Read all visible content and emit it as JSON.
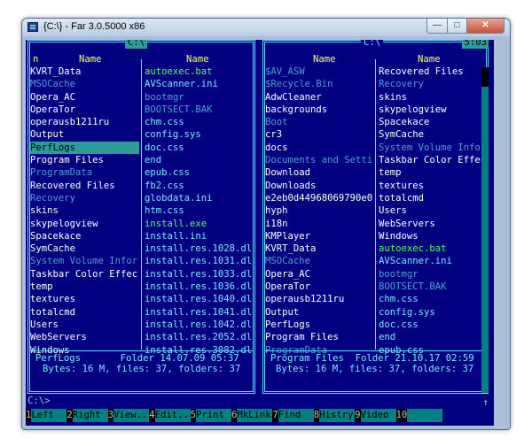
{
  "window": {
    "title": "{C:\\} - Far 3.0.5000 x86",
    "min_icon": "minimize-icon",
    "max_icon": "maximize-icon",
    "close_icon": "close-icon"
  },
  "left_panel": {
    "path": "C:\\",
    "columns": [
      "n",
      "Name",
      "Name"
    ],
    "col1": [
      {
        "name": "KVRT_Data",
        "kind": "n"
      },
      {
        "name": "MSOCache",
        "kind": "h"
      },
      {
        "name": "Opera_AC",
        "kind": "n"
      },
      {
        "name": "OperaTor",
        "kind": "n"
      },
      {
        "name": "operausb1211ru",
        "kind": "n"
      },
      {
        "name": "Output",
        "kind": "n"
      },
      {
        "name": "PerfLogs",
        "kind": "sel"
      },
      {
        "name": "Program Files",
        "kind": "n"
      },
      {
        "name": "ProgramData",
        "kind": "h"
      },
      {
        "name": "Recovered Files",
        "kind": "n"
      },
      {
        "name": "Recovery",
        "kind": "h"
      },
      {
        "name": "skins",
        "kind": "n"
      },
      {
        "name": "skypelogview",
        "kind": "n"
      },
      {
        "name": "Spacekace",
        "kind": "n"
      },
      {
        "name": "SymCache",
        "kind": "n"
      },
      {
        "name": "System Volume Infor",
        "kind": "h"
      },
      {
        "name": "Taskbar Color Effec",
        "kind": "n"
      },
      {
        "name": "temp",
        "kind": "n"
      },
      {
        "name": "textures",
        "kind": "n"
      },
      {
        "name": "totalcmd",
        "kind": "n"
      },
      {
        "name": "Users",
        "kind": "n"
      },
      {
        "name": "WebServers",
        "kind": "n"
      },
      {
        "name": "Windows",
        "kind": "n"
      }
    ],
    "col2": [
      {
        "name": "autoexec.bat",
        "kind": "x"
      },
      {
        "name": "AVScanner.ini",
        "kind": "f"
      },
      {
        "name": "bootmgr",
        "kind": "h"
      },
      {
        "name": "BOOTSECT.BAK",
        "kind": "h"
      },
      {
        "name": "chm.css",
        "kind": "f"
      },
      {
        "name": "config.sys",
        "kind": "f"
      },
      {
        "name": "doc.css",
        "kind": "f"
      },
      {
        "name": "end",
        "kind": "f"
      },
      {
        "name": "epub.css",
        "kind": "f"
      },
      {
        "name": "fb2.css",
        "kind": "f"
      },
      {
        "name": "globdata.ini",
        "kind": "f"
      },
      {
        "name": "htm.css",
        "kind": "f"
      },
      {
        "name": "install.exe",
        "kind": "x"
      },
      {
        "name": "install.ini",
        "kind": "f"
      },
      {
        "name": "install.res.1028.dl}",
        "kind": "f"
      },
      {
        "name": "install.res.1031.dl}",
        "kind": "f"
      },
      {
        "name": "install.res.1033.dl}",
        "kind": "f"
      },
      {
        "name": "install.res.1036.dl}",
        "kind": "f"
      },
      {
        "name": "install.res.1040.dl}",
        "kind": "f"
      },
      {
        "name": "install.res.1041.dl}",
        "kind": "f"
      },
      {
        "name": "install.res.1042.dl}",
        "kind": "f"
      },
      {
        "name": "install.res.2052.dl}",
        "kind": "f"
      },
      {
        "name": "install.res.3082.dl}",
        "kind": "f"
      }
    ],
    "info": "PerfLogs       Folder 14.07.09 05:37",
    "summary": "Bytes: 16 M, files: 37, folders: 37"
  },
  "right_panel": {
    "path": "C:\\",
    "clock": "5:03",
    "columns": [
      "Name",
      "Name"
    ],
    "col1": [
      {
        "name": "$AV_ASW",
        "kind": "h"
      },
      {
        "name": "$Recycle.Bin",
        "kind": "h"
      },
      {
        "name": "AdwCleaner",
        "kind": "n"
      },
      {
        "name": "backgrounds",
        "kind": "n"
      },
      {
        "name": "Boot",
        "kind": "h"
      },
      {
        "name": "cr3",
        "kind": "n"
      },
      {
        "name": "docs",
        "kind": "n"
      },
      {
        "name": "Documents and Setti",
        "kind": "h"
      },
      {
        "name": "Download",
        "kind": "n"
      },
      {
        "name": "Downloads",
        "kind": "n"
      },
      {
        "name": "e2eb0d44968069790e0",
        "kind": "n"
      },
      {
        "name": "hyph",
        "kind": "n"
      },
      {
        "name": "i18n",
        "kind": "n"
      },
      {
        "name": "KMPlayer",
        "kind": "n"
      },
      {
        "name": "KVRT_Data",
        "kind": "n"
      },
      {
        "name": "MSOCache",
        "kind": "h"
      },
      {
        "name": "Opera_AC",
        "kind": "n"
      },
      {
        "name": "OperaTor",
        "kind": "n"
      },
      {
        "name": "operausb1211ru",
        "kind": "n"
      },
      {
        "name": "Output",
        "kind": "n"
      },
      {
        "name": "PerfLogs",
        "kind": "n"
      },
      {
        "name": "Program Files",
        "kind": "n"
      },
      {
        "name": "ProgramData",
        "kind": "h"
      }
    ],
    "col2": [
      {
        "name": "Recovered Files",
        "kind": "n"
      },
      {
        "name": "Recovery",
        "kind": "h"
      },
      {
        "name": "skins",
        "kind": "n"
      },
      {
        "name": "skypelogview",
        "kind": "n"
      },
      {
        "name": "Spacekace",
        "kind": "n"
      },
      {
        "name": "SymCache",
        "kind": "n"
      },
      {
        "name": "System Volume Infor",
        "kind": "h"
      },
      {
        "name": "Taskbar Color Effec",
        "kind": "n"
      },
      {
        "name": "temp",
        "kind": "n"
      },
      {
        "name": "textures",
        "kind": "n"
      },
      {
        "name": "totalcmd",
        "kind": "n"
      },
      {
        "name": "Users",
        "kind": "n"
      },
      {
        "name": "WebServers",
        "kind": "n"
      },
      {
        "name": "Windows",
        "kind": "n"
      },
      {
        "name": "autoexec.bat",
        "kind": "x"
      },
      {
        "name": "AVScanner.ini",
        "kind": "f"
      },
      {
        "name": "bootmgr",
        "kind": "h"
      },
      {
        "name": "BOOTSECT.BAK",
        "kind": "h"
      },
      {
        "name": "chm.css",
        "kind": "f"
      },
      {
        "name": "config.sys",
        "kind": "f"
      },
      {
        "name": "doc.css",
        "kind": "f"
      },
      {
        "name": "end",
        "kind": "f"
      },
      {
        "name": "epub.css",
        "kind": "f"
      }
    ],
    "info": "Program Files  Folder 21.10.17 02:59",
    "summary": "Bytes: 16 M, files: 37, folders: 37"
  },
  "command_line": "C:\\>",
  "keybar": [
    {
      "num": "1",
      "label": "Left"
    },
    {
      "num": "2",
      "label": "Right"
    },
    {
      "num": "3",
      "label": "View.."
    },
    {
      "num": "4",
      "label": "Edit.."
    },
    {
      "num": "5",
      "label": "Print"
    },
    {
      "num": "6",
      "label": "MkLink"
    },
    {
      "num": "7",
      "label": "Find"
    },
    {
      "num": "8",
      "label": "Histry"
    },
    {
      "num": "9",
      "label": "Video"
    },
    {
      "num": "10",
      "label": ""
    }
  ],
  "colors": {
    "background": "#000080",
    "selection": "#2a9d96",
    "header": "#ffff55",
    "executable": "#55ff55",
    "hidden": "#4f9fd0"
  }
}
